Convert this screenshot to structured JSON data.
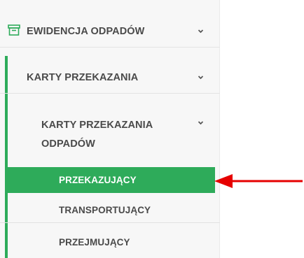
{
  "sidebar": {
    "section": {
      "label": "EWIDENCJA ODPADÓW",
      "icon": "archive-box-icon",
      "expanded": true
    },
    "group": {
      "label": "KARTY PRZEKAZANIA",
      "expanded": true
    },
    "subgroup": {
      "label": "KARTY PRZEKAZANIA ODPADÓW",
      "expanded": true
    },
    "items": [
      {
        "label": "PRZEKAZUJĄCY",
        "active": true
      },
      {
        "label": "TRANSPORTUJĄCY",
        "active": false
      },
      {
        "label": "PRZEJMUJĄCY",
        "active": false
      }
    ]
  },
  "annotation": {
    "icon": "red-arrow-icon",
    "color": "#e60000"
  },
  "colors": {
    "accent_green": "#2eab5a",
    "text": "#4a4a4a",
    "sidebar_bg": "#f7f7f7"
  }
}
